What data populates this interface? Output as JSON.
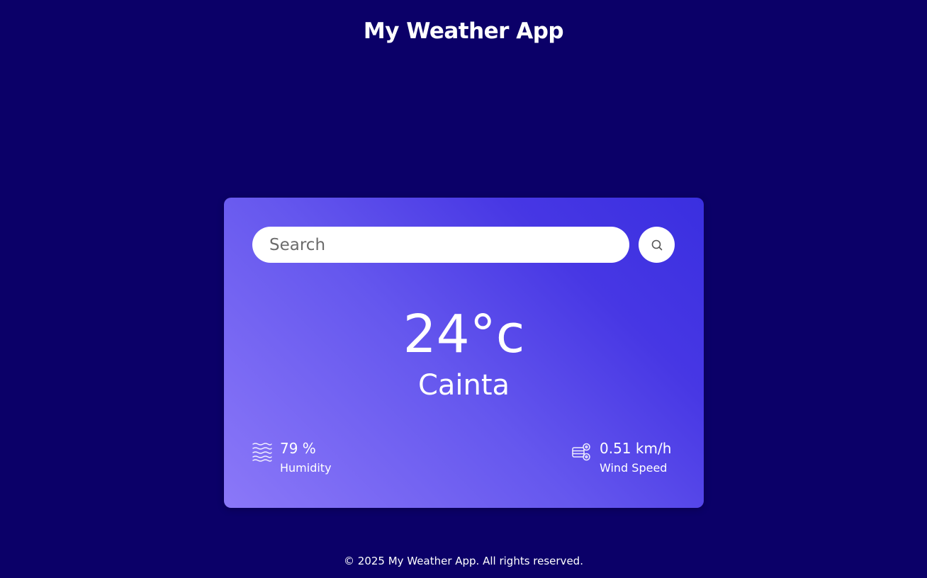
{
  "header": {
    "title": "My Weather App"
  },
  "search": {
    "placeholder": "Search",
    "value": "",
    "button_icon": "search-icon"
  },
  "weather": {
    "temperature": "24°c",
    "city": "Cainta"
  },
  "details": {
    "humidity": {
      "icon": "humidity-icon",
      "value": "79 %",
      "label": "Humidity"
    },
    "wind": {
      "icon": "wind-icon",
      "value": "0.51 km/h",
      "label": "Wind Speed"
    }
  },
  "footer": {
    "text": "© 2025 My Weather App. All rights reserved."
  },
  "colors": {
    "background": "#0b0068",
    "card_gradient_start": "#8b78f8",
    "card_gradient_end": "#3a2fe0",
    "text": "#ffffff"
  }
}
